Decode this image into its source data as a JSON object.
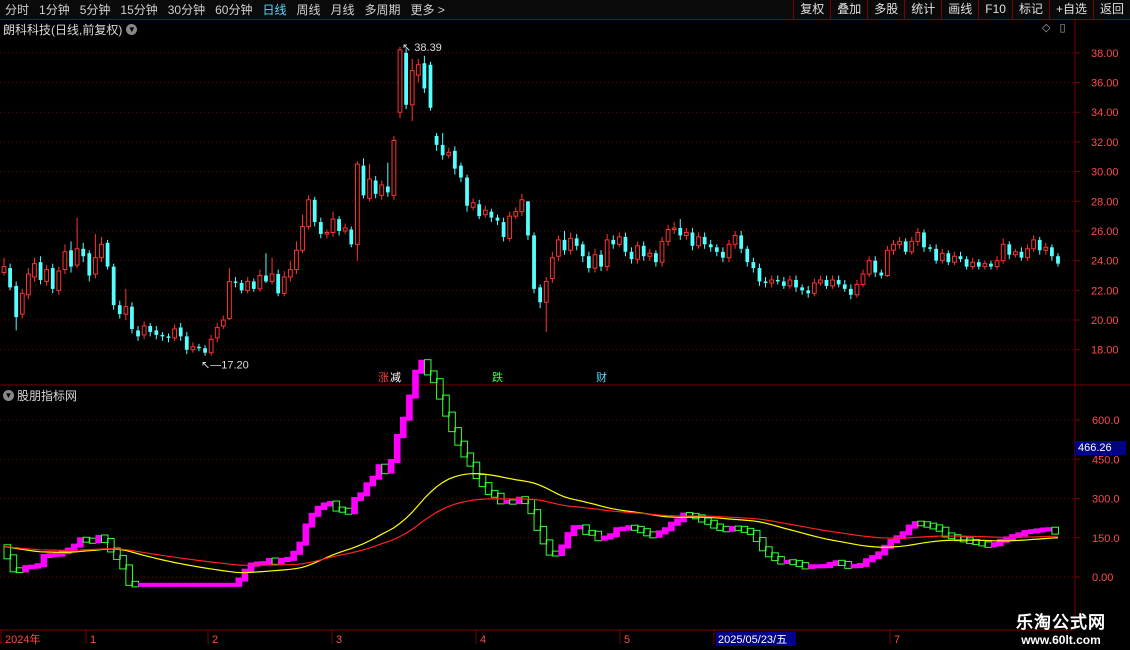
{
  "toolbar": {
    "periods": [
      "分时",
      "1分钟",
      "5分钟",
      "15分钟",
      "30分钟",
      "60分钟",
      "日线",
      "周线",
      "月线",
      "多周期",
      "更多 >"
    ],
    "active_period": "日线",
    "actions": [
      "复权",
      "叠加",
      "多股",
      "统计",
      "画线",
      "F10",
      "标记",
      "+自选",
      "返回"
    ]
  },
  "main_panel": {
    "title": "朗科科技(日线,前复权)",
    "high_label": "38.39",
    "low_label": "17.20"
  },
  "event_labels": [
    {
      "text": "涨",
      "color": "#ff4040",
      "x": 378
    },
    {
      "text": "减",
      "color": "#ffffff",
      "x": 390
    },
    {
      "text": "跌",
      "color": "#40ff40",
      "x": 492
    },
    {
      "text": "财",
      "color": "#5ad7ff",
      "x": 596
    }
  ],
  "indicator_panel": {
    "title": "股朋指标网",
    "current_value": "466.26"
  },
  "price_axis": {
    "labels": [
      "38.00",
      "36.00",
      "34.00",
      "32.00",
      "30.00",
      "28.00",
      "26.00",
      "24.00",
      "22.00",
      "20.00",
      "18.00"
    ]
  },
  "indicator_axis": {
    "labels": [
      "600.0",
      "450.0",
      "300.0",
      "150.0",
      "0.00"
    ]
  },
  "date_axis": {
    "labels": [
      {
        "text": "2024年",
        "x": 3
      },
      {
        "text": "1",
        "x": 88
      },
      {
        "text": "2",
        "x": 210
      },
      {
        "text": "3",
        "x": 334
      },
      {
        "text": "4",
        "x": 478
      },
      {
        "text": "5",
        "x": 622
      },
      {
        "text": "2025/05/23/五",
        "x": 716,
        "highlight": true
      },
      {
        "text": "7",
        "x": 892
      }
    ]
  },
  "watermark": {
    "line1": "乐淘公式网",
    "line2": "www.60lt.com"
  },
  "colors": {
    "up": "#ff3232",
    "down": "#54ffff",
    "grid": "#7a0000",
    "bull": "#ff00ff",
    "bear": "#33ff33",
    "ma_yellow": "#ffff00",
    "ma_red": "#ff2020"
  },
  "icons": [
    "chevron-down-icon",
    "diamond-icon",
    "menu-icon"
  ],
  "chart_data": {
    "type": "candlestick",
    "ylim": [
      16.5,
      39.0
    ],
    "candles": [
      [
        23.2,
        23.6,
        23.0,
        24.2
      ],
      [
        23.5,
        22.2,
        22.0,
        23.8
      ],
      [
        22.3,
        20.2,
        19.3,
        22.6
      ],
      [
        20.4,
        21.8,
        20.1,
        22.1
      ],
      [
        21.7,
        23.1,
        21.4,
        23.5
      ],
      [
        22.9,
        23.8,
        22.6,
        24.2
      ],
      [
        23.9,
        22.7,
        22.4,
        24.3
      ],
      [
        22.6,
        23.4,
        22.3,
        23.7
      ],
      [
        23.5,
        22.1,
        21.8,
        23.8
      ],
      [
        22.0,
        23.3,
        21.7,
        23.6
      ],
      [
        23.4,
        24.6,
        23.1,
        25.1
      ],
      [
        24.7,
        23.6,
        23.2,
        25.3
      ],
      [
        23.7,
        24.8,
        23.5,
        26.9
      ],
      [
        24.8,
        24.3,
        23.9,
        25.2
      ],
      [
        24.5,
        23.0,
        22.6,
        24.7
      ],
      [
        23.1,
        24.2,
        22.8,
        25.8
      ],
      [
        24.2,
        25.1,
        23.9,
        25.6
      ],
      [
        25.2,
        23.6,
        23.4,
        25.4
      ],
      [
        23.6,
        21.0,
        20.7,
        23.8
      ],
      [
        21.0,
        20.4,
        20.1,
        21.3
      ],
      [
        20.4,
        20.9,
        20.0,
        22.1
      ],
      [
        20.9,
        19.4,
        19.1,
        21.2
      ],
      [
        19.3,
        18.9,
        18.6,
        19.6
      ],
      [
        19.0,
        19.6,
        18.7,
        19.9
      ],
      [
        19.6,
        19.2,
        18.9,
        19.8
      ],
      [
        19.3,
        19.0,
        18.7,
        19.6
      ],
      [
        19.0,
        18.9,
        18.6,
        19.2
      ],
      [
        18.9,
        18.8,
        18.5,
        19.1
      ],
      [
        18.8,
        19.4,
        18.6,
        19.7
      ],
      [
        19.5,
        18.9,
        18.6,
        19.8
      ],
      [
        18.9,
        18.0,
        17.7,
        19.2
      ],
      [
        18.0,
        18.2,
        17.8,
        18.5
      ],
      [
        18.2,
        18.1,
        17.9,
        18.4
      ],
      [
        18.1,
        17.8,
        17.6,
        18.3
      ],
      [
        17.8,
        18.7,
        17.6,
        19.0
      ],
      [
        18.8,
        19.5,
        18.5,
        19.8
      ],
      [
        19.6,
        20.0,
        19.4,
        20.3
      ],
      [
        20.1,
        22.6,
        20.0,
        23.5
      ],
      [
        22.6,
        22.5,
        22.2,
        22.9
      ],
      [
        22.5,
        22.0,
        21.8,
        22.7
      ],
      [
        22.0,
        22.6,
        21.8,
        22.9
      ],
      [
        22.6,
        22.1,
        21.9,
        22.8
      ],
      [
        22.1,
        23.0,
        21.9,
        23.4
      ],
      [
        23.0,
        22.6,
        22.5,
        24.5
      ],
      [
        22.6,
        23.1,
        22.4,
        24.2
      ],
      [
        23.1,
        21.8,
        21.6,
        23.4
      ],
      [
        21.8,
        22.9,
        21.6,
        23.3
      ],
      [
        22.9,
        23.4,
        22.6,
        24.0
      ],
      [
        23.4,
        24.7,
        23.1,
        25.3
      ],
      [
        24.7,
        26.3,
        24.5,
        27.1
      ],
      [
        26.3,
        28.1,
        26.1,
        28.4
      ],
      [
        28.1,
        26.6,
        26.3,
        28.3
      ],
      [
        26.6,
        25.8,
        25.5,
        26.9
      ],
      [
        25.8,
        25.9,
        25.5,
        26.1
      ],
      [
        25.9,
        26.8,
        25.6,
        27.3
      ],
      [
        26.8,
        26.0,
        25.7,
        27.0
      ],
      [
        26.0,
        26.2,
        25.8,
        26.5
      ],
      [
        26.1,
        25.1,
        24.9,
        26.3
      ],
      [
        25.1,
        30.5,
        24.0,
        30.7
      ],
      [
        30.4,
        28.4,
        28.2,
        30.9
      ],
      [
        28.2,
        29.5,
        28.0,
        30.5
      ],
      [
        29.4,
        28.5,
        28.2,
        29.7
      ],
      [
        28.4,
        29.1,
        28.1,
        29.4
      ],
      [
        29.0,
        28.6,
        28.3,
        30.6
      ],
      [
        28.4,
        32.1,
        28.1,
        32.4
      ],
      [
        34.0,
        38.2,
        33.6,
        38.4
      ],
      [
        38.0,
        34.5,
        34.2,
        38.3
      ],
      [
        34.5,
        36.8,
        33.4,
        37.6
      ],
      [
        36.5,
        37.2,
        36.0,
        37.6
      ],
      [
        37.3,
        35.6,
        35.3,
        37.8
      ],
      [
        37.2,
        34.3,
        34.1,
        37.4
      ],
      [
        32.4,
        31.8,
        31.4,
        32.6
      ],
      [
        31.8,
        31.1,
        30.8,
        32.6
      ],
      [
        31.1,
        31.3,
        30.9,
        31.6
      ],
      [
        31.4,
        30.2,
        29.8,
        31.7
      ],
      [
        30.4,
        29.6,
        29.3,
        30.6
      ],
      [
        29.6,
        27.7,
        27.3,
        29.8
      ],
      [
        27.6,
        27.9,
        27.4,
        28.2
      ],
      [
        27.8,
        27.0,
        26.8,
        28.1
      ],
      [
        27.1,
        27.4,
        26.9,
        27.7
      ],
      [
        27.3,
        26.9,
        26.6,
        27.5
      ],
      [
        26.9,
        26.7,
        26.4,
        27.1
      ],
      [
        26.6,
        25.6,
        25.3,
        26.9
      ],
      [
        25.5,
        27.0,
        25.3,
        27.3
      ],
      [
        27.0,
        27.3,
        26.8,
        27.6
      ],
      [
        27.3,
        28.1,
        27.0,
        28.5
      ],
      [
        28.0,
        25.7,
        25.4,
        26.1
      ],
      [
        25.7,
        22.1,
        21.8,
        25.9
      ],
      [
        22.2,
        21.2,
        20.8,
        22.4
      ],
      [
        21.2,
        22.6,
        19.2,
        22.9
      ],
      [
        22.8,
        24.2,
        22.5,
        24.6
      ],
      [
        24.3,
        25.4,
        24.0,
        25.7
      ],
      [
        25.4,
        24.7,
        24.4,
        26.0
      ],
      [
        24.7,
        25.5,
        24.4,
        25.9
      ],
      [
        25.5,
        25.0,
        24.7,
        25.8
      ],
      [
        25.1,
        24.3,
        23.9,
        25.3
      ],
      [
        24.3,
        23.5,
        23.2,
        24.6
      ],
      [
        23.5,
        24.4,
        23.2,
        24.8
      ],
      [
        24.4,
        23.6,
        23.3,
        24.7
      ],
      [
        23.6,
        25.4,
        23.3,
        25.8
      ],
      [
        25.4,
        25.1,
        24.8,
        25.7
      ],
      [
        25.1,
        25.6,
        24.9,
        25.9
      ],
      [
        25.6,
        24.6,
        24.3,
        25.9
      ],
      [
        24.6,
        24.1,
        23.8,
        24.9
      ],
      [
        24.1,
        25.0,
        23.8,
        25.3
      ],
      [
        25.0,
        24.3,
        24.0,
        25.3
      ],
      [
        24.3,
        24.5,
        24.0,
        24.8
      ],
      [
        24.5,
        23.9,
        23.6,
        24.7
      ],
      [
        23.9,
        25.3,
        23.6,
        25.6
      ],
      [
        25.3,
        26.1,
        25.0,
        26.4
      ],
      [
        26.1,
        26.2,
        25.8,
        26.6
      ],
      [
        26.2,
        25.7,
        25.4,
        26.8
      ],
      [
        25.7,
        25.9,
        25.4,
        26.2
      ],
      [
        25.9,
        25.0,
        24.7,
        26.2
      ],
      [
        25.0,
        25.6,
        24.8,
        25.9
      ],
      [
        25.6,
        25.1,
        24.8,
        25.9
      ],
      [
        25.1,
        24.9,
        24.6,
        25.4
      ],
      [
        24.9,
        24.6,
        24.3,
        25.1
      ],
      [
        24.6,
        24.2,
        23.9,
        24.9
      ],
      [
        24.2,
        25.1,
        23.9,
        25.4
      ],
      [
        25.1,
        25.7,
        24.8,
        26.0
      ],
      [
        25.7,
        24.8,
        24.5,
        26.0
      ],
      [
        24.8,
        23.9,
        23.6,
        25.0
      ],
      [
        23.9,
        23.5,
        23.2,
        24.2
      ],
      [
        23.5,
        22.6,
        22.3,
        23.8
      ],
      [
        22.6,
        22.5,
        22.2,
        22.9
      ],
      [
        22.5,
        22.7,
        22.2,
        23.0
      ],
      [
        22.7,
        22.6,
        22.4,
        23.0
      ],
      [
        22.6,
        22.3,
        22.1,
        22.9
      ],
      [
        22.3,
        22.7,
        22.1,
        23.0
      ],
      [
        22.7,
        22.2,
        21.9,
        23.0
      ],
      [
        22.2,
        22.0,
        21.7,
        22.4
      ],
      [
        22.0,
        21.8,
        21.5,
        22.3
      ],
      [
        21.8,
        22.5,
        21.6,
        22.8
      ],
      [
        22.5,
        22.7,
        22.3,
        23.0
      ],
      [
        22.7,
        22.3,
        22.1,
        23.0
      ],
      [
        22.3,
        22.7,
        22.1,
        23.0
      ],
      [
        22.7,
        22.4,
        22.2,
        23.0
      ],
      [
        22.4,
        22.1,
        21.9,
        22.7
      ],
      [
        22.1,
        21.7,
        21.4,
        22.4
      ],
      [
        21.7,
        22.4,
        21.5,
        22.7
      ],
      [
        22.4,
        23.1,
        22.2,
        23.4
      ],
      [
        23.1,
        24.0,
        22.9,
        24.3
      ],
      [
        24.0,
        23.2,
        22.9,
        24.3
      ],
      [
        23.2,
        23.0,
        22.8,
        23.4
      ],
      [
        23.0,
        24.7,
        22.9,
        25.0
      ],
      [
        24.7,
        25.1,
        24.4,
        25.4
      ],
      [
        25.1,
        25.3,
        24.8,
        25.6
      ],
      [
        25.3,
        24.6,
        24.4,
        25.5
      ],
      [
        24.6,
        25.3,
        24.4,
        25.6
      ],
      [
        25.3,
        25.9,
        25.0,
        26.2
      ],
      [
        25.9,
        24.9,
        24.6,
        26.1
      ],
      [
        24.9,
        24.8,
        24.6,
        25.1
      ],
      [
        24.8,
        24.0,
        23.8,
        25.1
      ],
      [
        24.0,
        24.5,
        23.8,
        24.8
      ],
      [
        24.5,
        23.9,
        23.7,
        24.7
      ],
      [
        23.9,
        24.3,
        23.7,
        24.6
      ],
      [
        24.3,
        24.1,
        23.9,
        24.6
      ],
      [
        24.1,
        23.6,
        23.4,
        24.3
      ],
      [
        23.6,
        23.9,
        23.4,
        24.2
      ],
      [
        23.9,
        23.6,
        23.4,
        24.1
      ],
      [
        23.6,
        23.8,
        23.4,
        24.0
      ],
      [
        23.8,
        23.6,
        23.4,
        24.0
      ],
      [
        23.6,
        24.0,
        23.4,
        24.3
      ],
      [
        24.0,
        25.1,
        23.8,
        25.5
      ],
      [
        25.1,
        24.4,
        24.1,
        25.3
      ],
      [
        24.4,
        24.6,
        24.2,
        24.8
      ],
      [
        24.6,
        24.2,
        24.0,
        24.9
      ],
      [
        24.2,
        24.8,
        24.0,
        25.1
      ],
      [
        24.8,
        25.4,
        24.6,
        25.7
      ],
      [
        25.4,
        24.7,
        24.4,
        25.6
      ],
      [
        24.7,
        24.9,
        24.4,
        25.2
      ],
      [
        24.9,
        24.3,
        24.0,
        25.1
      ],
      [
        24.3,
        23.8,
        23.6,
        24.5
      ]
    ]
  }
}
